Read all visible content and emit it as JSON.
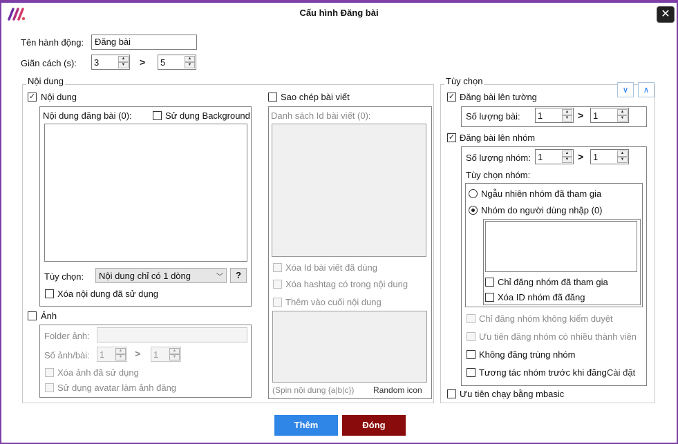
{
  "window": {
    "title": "Cấu hình Đăng bài",
    "close": "✕"
  },
  "top": {
    "action_name_label": "Tên hành động:",
    "action_name_value": "Đăng bài",
    "interval_label": "Giãn cách (s):",
    "interval_min": "3",
    "interval_max": "5",
    "gt": ">"
  },
  "content_group": {
    "legend": "Nội dung",
    "content_check_label": "Nội dung",
    "post_content_label": "Nội dung đăng bài (0):",
    "use_background_label": "Sử dụng Background",
    "option_label": "Tùy chọn:",
    "option_value": "Nội dung chỉ có 1 dòng",
    "help": "?",
    "delete_used_content": "Xóa nội dung đã sử dụng",
    "image_check_label": "Ảnh",
    "folder_label": "Folder ảnh:",
    "images_per_post_label": "Số ảnh/bài:",
    "images_min": "1",
    "images_max": "1",
    "delete_used_images": "Xóa ảnh đã sử dụng",
    "use_avatar": "Sử dụng avatar làm ảnh đăng"
  },
  "copy_group": {
    "copy_check_label": "Sao chép bài viết",
    "id_list_label": "Danh sách Id bài viết (0):",
    "delete_used_ids": "Xóa Id bài viết đã dùng",
    "delete_hashtag": "Xóa hashtag có trong nội dung",
    "append_content": "Thêm vào cuối nội dung",
    "spin_hint": "(Spin nội dung {a|b|c})",
    "random_icon": "Random icon"
  },
  "options_group": {
    "legend": "Tùy chọn",
    "post_wall_label": "Đăng bài lên tường",
    "post_count_label": "Số lượng bài:",
    "post_count_min": "1",
    "post_count_max": "1",
    "post_group_label": "Đăng bài lên nhóm",
    "group_count_label": "Số lượng nhóm:",
    "group_count_min": "1",
    "group_count_max": "1",
    "group_options_label": "Tùy chọn nhóm:",
    "random_joined": "Ngẫu nhiên nhóm đã tham gia",
    "user_input_groups": "Nhóm do người dùng nhập (0)",
    "only_joined": "Chỉ đăng nhóm đã tham gia",
    "delete_posted_ids": "Xóa ID nhóm đã đăng",
    "only_unmoderated": "Chỉ đăng nhóm không kiểm duyệt",
    "prefer_large": "Ưu tiên đăng nhóm có nhiều thành viên",
    "no_duplicate": "Không đăng trùng nhóm",
    "interact_before": "Tương tác nhóm trước khi đăng",
    "settings_link": "Cài đặt",
    "mbasic": "Ưu tiên chạy bằng mbasic"
  },
  "footer": {
    "add": "Thêm",
    "close": "Đóng"
  },
  "colors": {
    "border": "#7d3fa7",
    "add": "#2f86e6",
    "close": "#8a0b0b",
    "accent": "#1e7be3"
  }
}
